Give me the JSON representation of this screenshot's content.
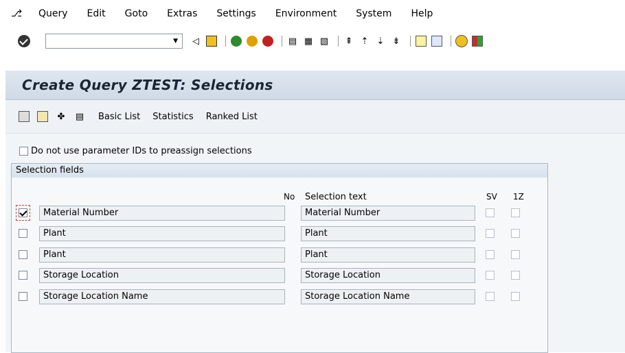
{
  "menu": {
    "items": [
      {
        "label": "Query"
      },
      {
        "label": "Edit"
      },
      {
        "label": "Goto"
      },
      {
        "label": "Extras"
      },
      {
        "label": "Settings"
      },
      {
        "label": "Environment"
      },
      {
        "label": "System"
      },
      {
        "label": "Help"
      }
    ]
  },
  "toolbar": {
    "command_field": {
      "value": "",
      "placeholder": ""
    },
    "icons": [
      "enter-icon",
      "back-arrow-icon",
      "save-icon",
      "back-icon",
      "exit-icon",
      "cancel-icon",
      "print-icon",
      "find-icon",
      "find-next-icon",
      "first-page-icon",
      "previous-page-icon",
      "next-page-icon",
      "last-page-icon",
      "new-session-icon",
      "shortcut-icon",
      "help-icon",
      "layout-icon"
    ]
  },
  "title": "Create Query ZTEST: Selections",
  "app_toolbar": {
    "icons": [
      "save-variant-icon",
      "execute-icon",
      "display-icon",
      "list-icon"
    ],
    "buttons": [
      "Basic List",
      "Statistics",
      "Ranked List"
    ]
  },
  "option": {
    "label": "Do not use parameter IDs to preassign selections",
    "checked": false
  },
  "group": {
    "title": "Selection fields",
    "columns": {
      "no": "No",
      "selection_text": "Selection text",
      "sv": "SV",
      "z": "1Z"
    },
    "rows": [
      {
        "checked": true,
        "field": "Material Number",
        "text": "Material Number"
      },
      {
        "checked": false,
        "field": "Plant",
        "text": "Plant"
      },
      {
        "checked": false,
        "field": "Plant",
        "text": "Plant"
      },
      {
        "checked": false,
        "field": "Storage Location",
        "text": "Storage Location"
      },
      {
        "checked": false,
        "field": "Storage Location Name",
        "text": "Storage Location Name"
      }
    ]
  },
  "colors": {
    "accent": "#d04040",
    "title_bg": "#dfe7f0"
  }
}
